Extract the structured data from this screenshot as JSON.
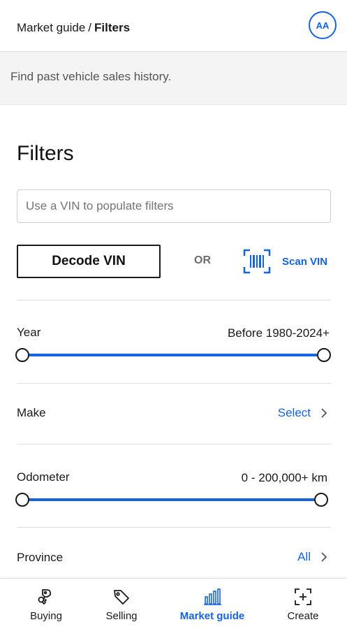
{
  "header": {
    "breadcrumb_parent": "Market guide",
    "breadcrumb_separator": "/",
    "breadcrumb_current": "Filters",
    "avatar_initials": "AA"
  },
  "banner": {
    "text": "Find past vehicle sales history."
  },
  "filters": {
    "title": "Filters",
    "vin_placeholder": "Use a VIN to populate filters",
    "decode_label": "Decode VIN",
    "or_label": "OR",
    "scan_label": "Scan VIN",
    "year": {
      "label": "Year",
      "value": "Before 1980-2024+",
      "range_fraction": [
        0,
        1
      ]
    },
    "make": {
      "label": "Make",
      "action": "Select"
    },
    "odometer": {
      "label": "Odometer",
      "value": "0 - 200,000+ km",
      "range_fraction": [
        0,
        1
      ]
    },
    "province": {
      "label": "Province",
      "action": "All"
    }
  },
  "nav": {
    "items": [
      {
        "label": "Buying",
        "icon": "car-keys-icon",
        "active": false
      },
      {
        "label": "Selling",
        "icon": "price-tag-icon",
        "active": false
      },
      {
        "label": "Market guide",
        "icon": "bar-chart-icon",
        "active": true
      },
      {
        "label": "Create",
        "icon": "add-photo-icon",
        "active": false
      }
    ]
  },
  "colors": {
    "accent": "#1463e0",
    "text": "#1a1a1a",
    "banner_bg": "#f4f4f4"
  }
}
